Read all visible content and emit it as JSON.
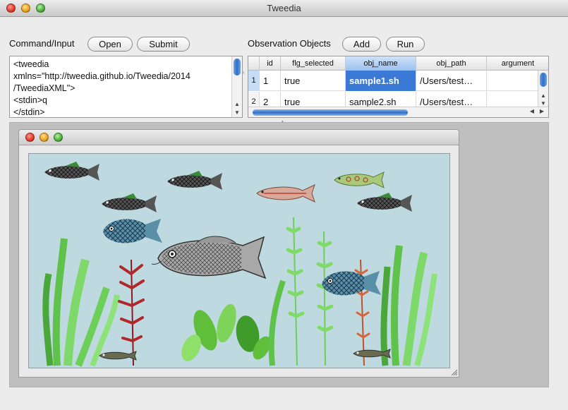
{
  "window": {
    "title": "Tweedia"
  },
  "input_panel": {
    "label": "Command/Input",
    "open_label": "Open",
    "submit_label": "Submit",
    "text_lines": [
      "<tweedia",
      "xmlns=\"http://tweedia.github.io/Tweedia/2014",
      "/TweediaXML\">",
      "<stdin>q",
      "</stdin>"
    ]
  },
  "observation_panel": {
    "label": "Observation Objects",
    "add_label": "Add",
    "run_label": "Run",
    "columns": [
      "",
      "id",
      "flg_selected",
      "obj_name",
      "obj_path",
      "argument"
    ],
    "rows": [
      {
        "rownum": "1",
        "id": "1",
        "flg_selected": "true",
        "obj_name": "sample1.sh",
        "obj_path": "/Users/test…",
        "argument": ""
      },
      {
        "rownum": "2",
        "id": "2",
        "flg_selected": "true",
        "obj_name": "sample2.sh",
        "obj_path": "/Users/test…",
        "argument": ""
      }
    ]
  },
  "aquarium": {
    "background_color": "#bfd9e0",
    "fish": [
      {
        "kind": "dark-fish"
      },
      {
        "kind": "dark-fish"
      },
      {
        "kind": "dark-fish"
      },
      {
        "kind": "dark-fish"
      },
      {
        "kind": "green-fish"
      },
      {
        "kind": "pink-fish"
      },
      {
        "kind": "blue-fish"
      },
      {
        "kind": "carp"
      },
      {
        "kind": "blue-fish"
      },
      {
        "kind": "catfish"
      },
      {
        "kind": "catfish"
      }
    ],
    "plants": [
      "green-plant",
      "red-plant",
      "green-plant",
      "green-plant",
      "red-plant",
      "green-plant"
    ]
  },
  "colors": {
    "selection": "#3a7ad6",
    "scroll_thumb": "#2f6fc8"
  }
}
